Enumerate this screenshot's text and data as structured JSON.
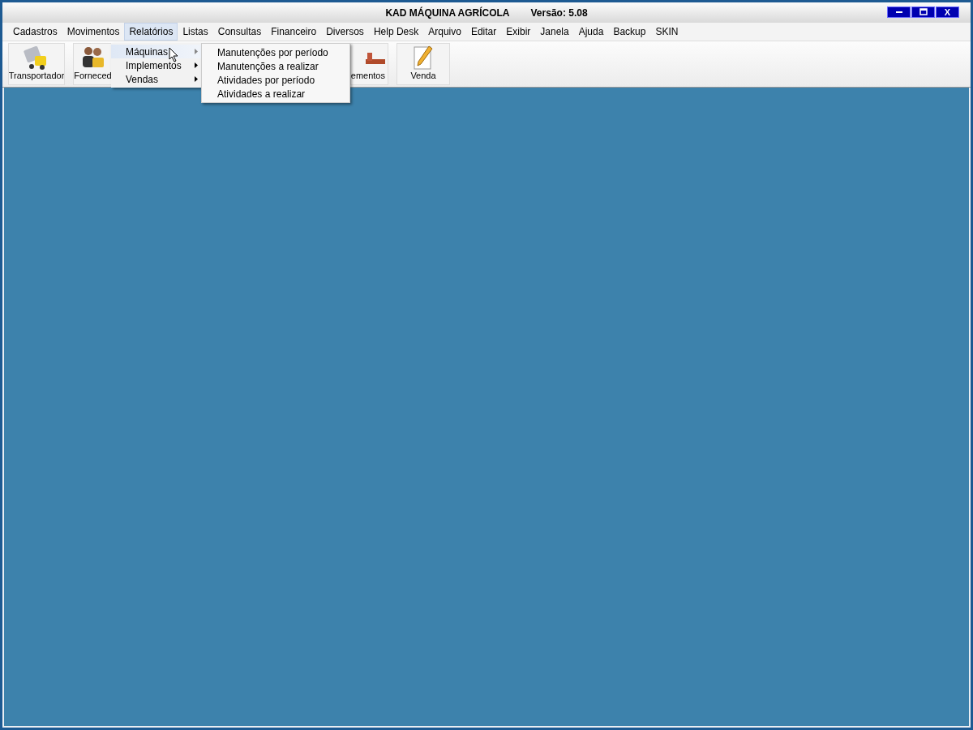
{
  "window": {
    "title": "KAD MÁQUINA AGRÍCOLA",
    "version": "Versão: 5.08",
    "controls": [
      {
        "kind": "minimize"
      },
      {
        "kind": "maximize"
      },
      {
        "kind": "close",
        "label": "X"
      }
    ]
  },
  "menu_bar": [
    {
      "label": "Cadastros",
      "selected": false
    },
    {
      "label": "Movimentos",
      "selected": false
    },
    {
      "label": "Relatórios",
      "selected": true
    },
    {
      "label": "Listas",
      "selected": false
    },
    {
      "label": "Consultas",
      "selected": false
    },
    {
      "label": "Financeiro",
      "selected": false
    },
    {
      "label": "Diversos",
      "selected": false
    },
    {
      "label": "Help Desk",
      "selected": false
    },
    {
      "label": "Arquivo",
      "selected": false
    },
    {
      "label": "Editar",
      "selected": false
    },
    {
      "label": "Exibir",
      "selected": false
    },
    {
      "label": "Janela",
      "selected": false
    },
    {
      "label": "Ajuda",
      "selected": false
    },
    {
      "label": "Backup",
      "selected": false
    },
    {
      "label": "SKIN",
      "selected": false
    }
  ],
  "toolbar": [
    {
      "label": "Transportador"
    },
    {
      "label": "Forneced"
    },
    {
      "label": "ementos"
    },
    {
      "label": "Venda"
    }
  ],
  "dropdown": [
    {
      "label": "Máquinas",
      "selected": true
    },
    {
      "label": "Implementos",
      "selected": false
    },
    {
      "label": "Vendas",
      "selected": false
    }
  ],
  "submenu": [
    "Manutenções por período",
    "Manutenções a realizar",
    "Atividades por período",
    "Atividades a realizar"
  ]
}
